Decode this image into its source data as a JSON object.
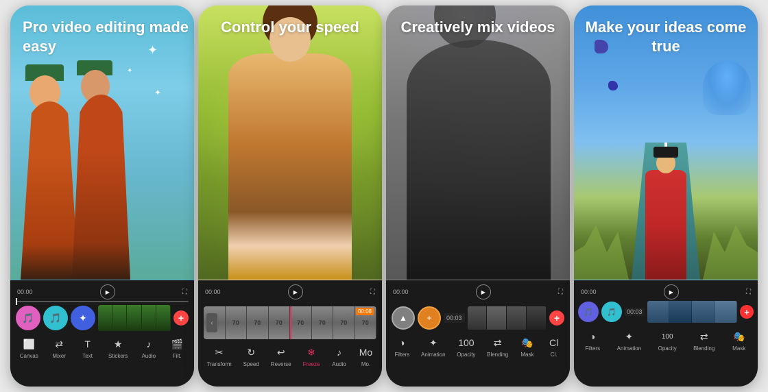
{
  "cards": [
    {
      "id": "card1",
      "title": "Pro video editing\nmade easy",
      "toolbar_items": [
        {
          "icon": "⬜",
          "label": "Canvas"
        },
        {
          "icon": "🔀",
          "label": "Mixer"
        },
        {
          "icon": "T",
          "label": "Text"
        },
        {
          "icon": "⭐",
          "label": "Stickers"
        },
        {
          "icon": "🔊",
          "label": "Audio"
        },
        {
          "icon": "🎬",
          "label": "Filt"
        }
      ],
      "time": "00:00"
    },
    {
      "id": "card2",
      "title": "Control your\nspeed",
      "toolbar_items": [
        {
          "icon": "✂️",
          "label": "Transform"
        },
        {
          "icon": "🔄",
          "label": "Speed"
        },
        {
          "icon": "↩",
          "label": "Reverse"
        },
        {
          "icon": "❄",
          "label": "Freeze"
        },
        {
          "icon": "🔊",
          "label": "Audio"
        },
        {
          "icon": "🎬",
          "label": "Mo"
        }
      ],
      "time": "00:00"
    },
    {
      "id": "card3",
      "title": "Creatively mix\nvideos",
      "toolbar_items": [
        {
          "icon": "🎨",
          "label": "Filters"
        },
        {
          "icon": "✨",
          "label": "Animation"
        },
        {
          "icon": "💧",
          "label": "Opacity"
        },
        {
          "icon": "🔀",
          "label": "Blending"
        },
        {
          "icon": "🎭",
          "label": "Mask"
        },
        {
          "icon": "Cl",
          "label": "Cl"
        }
      ],
      "time": "00:00"
    },
    {
      "id": "card4",
      "title": "Make your ideas\ncome true",
      "toolbar_items": [
        {
          "icon": "🎨",
          "label": "Filters"
        },
        {
          "icon": "✨",
          "label": "Animation"
        },
        {
          "icon": "💧",
          "label": "Opacity"
        },
        {
          "icon": "🔀",
          "label": "Blending"
        },
        {
          "icon": "🎭",
          "label": "Mask"
        }
      ],
      "time": "00:00"
    }
  ]
}
